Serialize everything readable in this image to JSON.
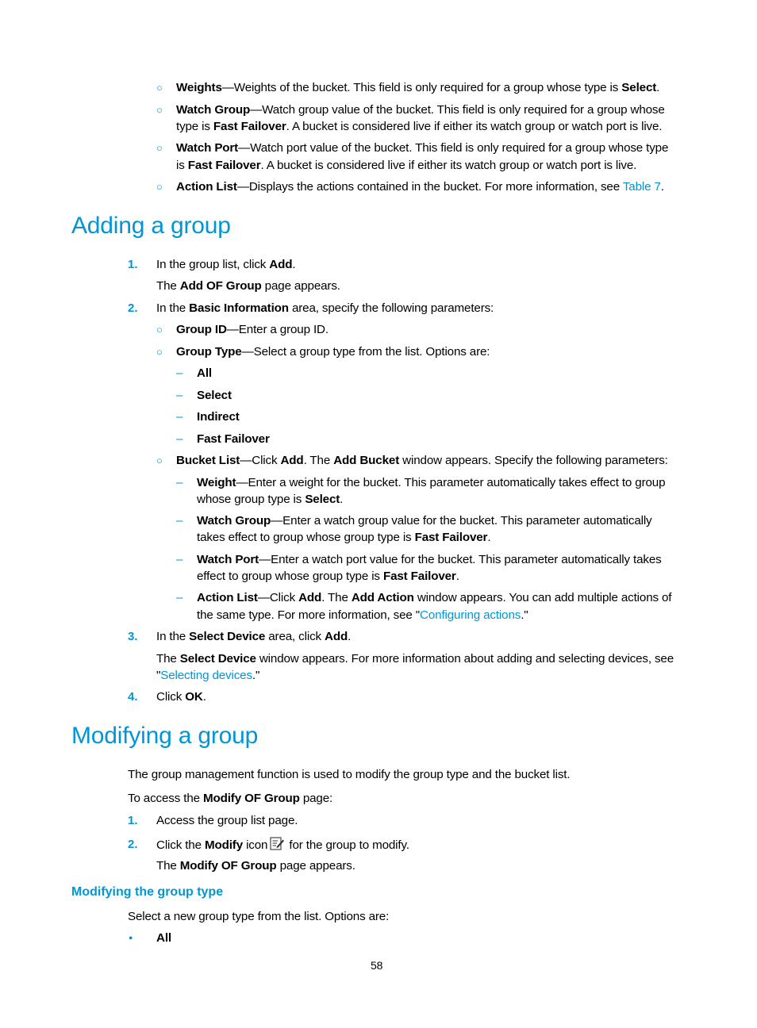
{
  "top_list": [
    {
      "term": "Weights",
      "text": "—Weights of the bucket. This field is only required for a group whose type is ",
      "bold2": "Select",
      "tail": "."
    },
    {
      "term": "Watch Group",
      "text": "—Watch group value of the bucket. This field is only required for a group whose",
      "line2_pre": "type is ",
      "bold2": "Fast Failover",
      "line2_post": ". A bucket is considered live if either its watch group or watch port is live."
    },
    {
      "term": "Watch Port",
      "text": "—Watch port value of the bucket. This field is only required for a group whose type",
      "line2_pre": "is ",
      "bold2": "Fast Failover",
      "line2_post": ". A bucket is considered live if either its watch group or watch port is live."
    },
    {
      "term": "Action List",
      "text": "—Displays the actions contained in the bucket. For more information, see ",
      "link": "Table 7",
      "tail": "."
    }
  ],
  "section1": {
    "heading": "Adding a group",
    "step1": {
      "num": "1.",
      "pre": "In the group list, click ",
      "bold": "Add",
      "post": ".",
      "note_pre": "The ",
      "note_bold": "Add OF Group",
      "note_post": " page appears."
    },
    "step2": {
      "num": "2.",
      "pre": "In the ",
      "bold": "Basic Information",
      "post": " area, specify the following parameters:"
    },
    "group_id": {
      "term": "Group ID",
      "text": "—Enter a group ID."
    },
    "group_type": {
      "term": "Group Type",
      "text": "—Select a group type from the list. Options are:"
    },
    "group_type_options": [
      "All",
      "Select",
      "Indirect",
      "Fast Failover"
    ],
    "bucket_list": {
      "term": "Bucket List",
      "t1": "—Click ",
      "b1": "Add",
      "t2": ". The ",
      "b2": "Add Bucket",
      "t3": " window appears. Specify the following parameters:"
    },
    "bucket_params": {
      "weight": {
        "term": "Weight",
        "l1": "—Enter a weight for the bucket. This parameter automatically takes effect to group",
        "l2_pre": "whose group type is ",
        "l2_bold": "Select",
        "l2_post": "."
      },
      "watch_group": {
        "term": "Watch Group",
        "l1": "—Enter a watch group value for the bucket. This parameter automatically",
        "l2_pre": "takes effect to group whose group type is ",
        "l2_bold": "Fast Failover",
        "l2_post": "."
      },
      "watch_port": {
        "term": "Watch Port",
        "l1": "—Enter a watch port value for the bucket. This parameter automatically takes",
        "l2_pre": "effect to group whose group type is ",
        "l2_bold": "Fast Failover",
        "l2_post": "."
      },
      "action_list": {
        "term": "Action List",
        "t1": "—Click ",
        "b1": "Add",
        "t2": ". The ",
        "b2": "Add Action",
        "t3": " window appears. You can add multiple actions of",
        "l2_pre": "the same type. For more information, see \"",
        "l2_link": "Configuring actions",
        "l2_post": ".\""
      }
    },
    "step3": {
      "num": "3.",
      "pre": "In the ",
      "bold": "Select Device",
      "mid": " area, click ",
      "bold2": "Add",
      "post": ".",
      "note_pre": "The ",
      "note_bold": "Select Device",
      "note_post": " window appears. For more information about adding and selecting devices, see",
      "note2_pre": "\"",
      "note2_link": "Selecting devices",
      "note2_post": ".\""
    },
    "step4": {
      "num": "4.",
      "pre": "Click ",
      "bold": "OK",
      "post": "."
    }
  },
  "section2": {
    "heading": "Modifying a group",
    "intro": "The group management function is used to modify the group type and the bucket list.",
    "access_pre": "To access the ",
    "access_bold": "Modify OF Group",
    "access_post": " page:",
    "step1": {
      "num": "1.",
      "text": "Access the group list page."
    },
    "step2": {
      "num": "2.",
      "pre": "Click the ",
      "bold": "Modify",
      "mid": " icon",
      "icon": "edit-icon",
      "post": " for the group to modify.",
      "note_pre": "The ",
      "note_bold": "Modify OF Group",
      "note_post": " page appears."
    },
    "subheading": "Modifying the group type",
    "sub_intro": "Select a new group type from the list. Options are:",
    "options": [
      "All"
    ]
  },
  "footer": {
    "page_number": "58"
  },
  "colors": {
    "accent": "#0096d6",
    "text": "#000000"
  }
}
